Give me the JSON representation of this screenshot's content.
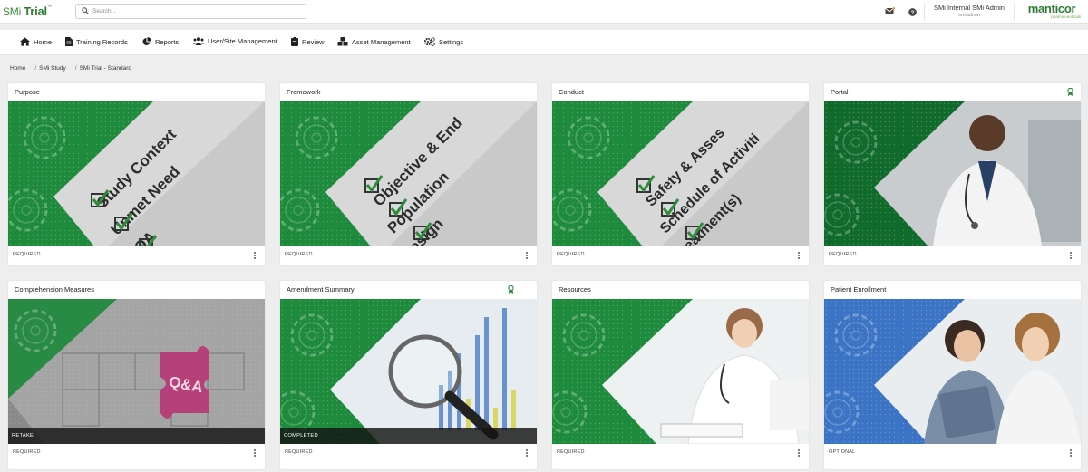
{
  "app": {
    "logo_light": "SMi ",
    "logo_bold": "Trial",
    "logo_tm": "™",
    "search_placeholder": "Search..."
  },
  "header": {
    "user_name": "SMi Internal SMi Admin",
    "user_login": "smiadmin",
    "brand_name": "manticor",
    "brand_sub": "pharmaceuticals"
  },
  "nav": [
    {
      "label": "Home",
      "icon": "home-icon"
    },
    {
      "label": "Training Records",
      "icon": "document-icon"
    },
    {
      "label": "Reports",
      "icon": "pie-chart-icon"
    },
    {
      "label": "User/Site Management",
      "icon": "users-icon"
    },
    {
      "label": "Review",
      "icon": "clipboard-icon"
    },
    {
      "label": "Asset Management",
      "icon": "cubes-icon"
    },
    {
      "label": "Settings",
      "icon": "gears-icon"
    }
  ],
  "breadcrumb": [
    "Home",
    "SMi Study",
    "SMi Trial - Standard"
  ],
  "cards": [
    {
      "title": "Purpose",
      "status": "REQUIRED",
      "overlay": "",
      "award": false,
      "items": [
        "Study Context",
        "Unmet Need",
        "MOA"
      ]
    },
    {
      "title": "Framework",
      "status": "REQUIRED",
      "overlay": "",
      "award": false,
      "items": [
        "Objective & End",
        "Population",
        "Design"
      ]
    },
    {
      "title": "Conduct",
      "status": "REQUIRED",
      "overlay": "",
      "award": false,
      "items": [
        "Safety & Asses",
        "Schedule of Activiti",
        "Treatment(s)"
      ]
    },
    {
      "title": "Portal",
      "status": "REQUIRED",
      "overlay": "",
      "award": true,
      "items": []
    },
    {
      "title": "Comprehension Measures",
      "status": "REQUIRED",
      "overlay": "RETAKE",
      "award": false,
      "items": [
        "Q&A"
      ]
    },
    {
      "title": "Amendment Summary",
      "status": "REQUIRED",
      "overlay": "COMPLETED",
      "award": true,
      "items": []
    },
    {
      "title": "Resources",
      "status": "REQUIRED",
      "overlay": "",
      "award": false,
      "items": []
    },
    {
      "title": "Patient Enrollment",
      "status": "OPTIONAL",
      "overlay": "",
      "award": false,
      "items": []
    }
  ],
  "colors": {
    "accent_green": "#1e8a3c",
    "dark_green": "#0f6a2c",
    "enroll_blue": "#3b74c4",
    "puzzle_magenta": "#b5407a"
  }
}
